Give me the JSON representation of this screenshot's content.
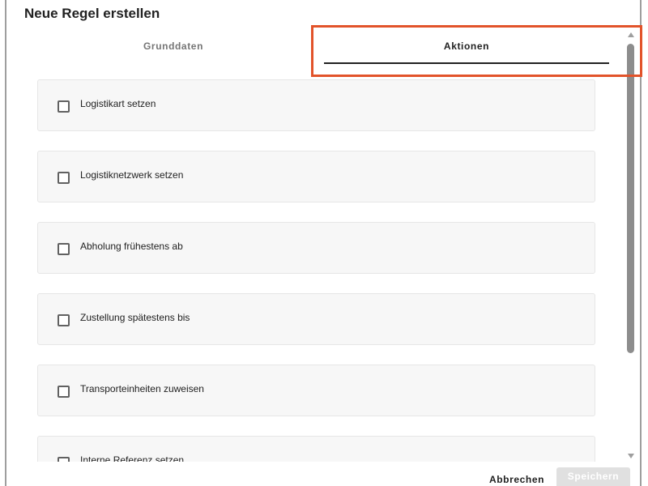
{
  "dialog": {
    "title": "Neue Regel erstellen"
  },
  "tabs": [
    {
      "label": "Grunddaten",
      "active": false
    },
    {
      "label": "Aktionen",
      "active": true
    }
  ],
  "actions": [
    {
      "label": "Logistikart setzen",
      "checked": false
    },
    {
      "label": "Logistiknetzwerk setzen",
      "checked": false
    },
    {
      "label": "Abholung frühestens ab",
      "checked": false
    },
    {
      "label": "Zustellung spätestens bis",
      "checked": false
    },
    {
      "label": "Transporteinheiten zuweisen",
      "checked": false
    },
    {
      "label": "Interne Referenz setzen",
      "checked": false
    }
  ],
  "footer": {
    "cancel_label": "Abbrechen",
    "save_label": "Speichern"
  },
  "colors": {
    "highlight": "#e2532a",
    "active_tab_underline": "#212121"
  }
}
